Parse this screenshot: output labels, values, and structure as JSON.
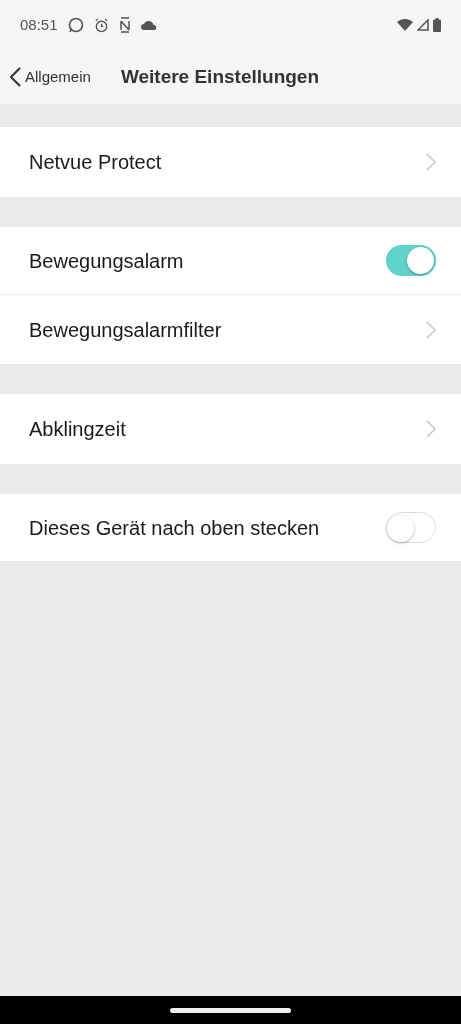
{
  "status_bar": {
    "time": "08:51"
  },
  "header": {
    "back_label": "Allgemein",
    "title": "Weitere Einstellungen"
  },
  "groups": [
    {
      "items": [
        {
          "kind": "link",
          "label": "Netvue Protect"
        }
      ]
    },
    {
      "items": [
        {
          "kind": "toggle",
          "label": "Bewegungsalarm",
          "on": true
        },
        {
          "kind": "link",
          "label": "Bewegungsalarmfilter"
        }
      ]
    },
    {
      "items": [
        {
          "kind": "link",
          "label": "Abklingzeit"
        }
      ]
    },
    {
      "items": [
        {
          "kind": "toggle",
          "label": "Dieses Gerät nach oben stecken",
          "on": false
        }
      ]
    }
  ]
}
